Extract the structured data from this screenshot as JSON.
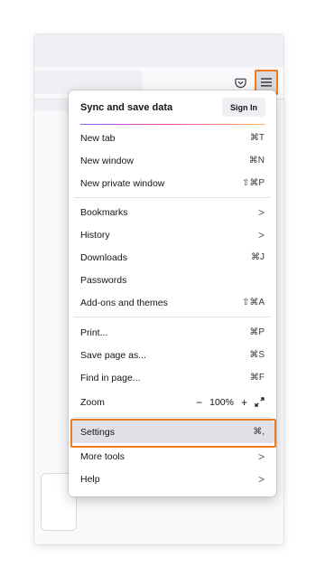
{
  "toolbar": {
    "pocket_icon": "pocket-icon",
    "menu_icon": "hamburger-menu-icon"
  },
  "menu": {
    "sync_title": "Sync and save data",
    "sign_in": "Sign In",
    "items": [
      {
        "label": "New tab",
        "shortcut": "⌘T"
      },
      {
        "label": "New window",
        "shortcut": "⌘N"
      },
      {
        "label": "New private window",
        "shortcut": "⇧⌘P"
      },
      {
        "label": "Bookmarks",
        "shortcut": ">"
      },
      {
        "label": "History",
        "shortcut": ">"
      },
      {
        "label": "Downloads",
        "shortcut": "⌘J"
      },
      {
        "label": "Passwords",
        "shortcut": ""
      },
      {
        "label": "Add-ons and themes",
        "shortcut": "⇧⌘A"
      },
      {
        "label": "Print...",
        "shortcut": "⌘P"
      },
      {
        "label": "Save page as...",
        "shortcut": "⌘S"
      },
      {
        "label": "Find in page...",
        "shortcut": "⌘F"
      },
      {
        "label": "Settings",
        "shortcut": "⌘,"
      },
      {
        "label": "More tools",
        "shortcut": ">"
      },
      {
        "label": "Help",
        "shortcut": ">"
      }
    ],
    "zoom": {
      "label": "Zoom",
      "minus": "−",
      "value": "100%",
      "plus": "+"
    }
  },
  "colors": {
    "highlight_outline": "#f07b1e",
    "accent_gradient": [
      "#9059ff",
      "#ff4aa2",
      "#ffbd4f"
    ]
  }
}
